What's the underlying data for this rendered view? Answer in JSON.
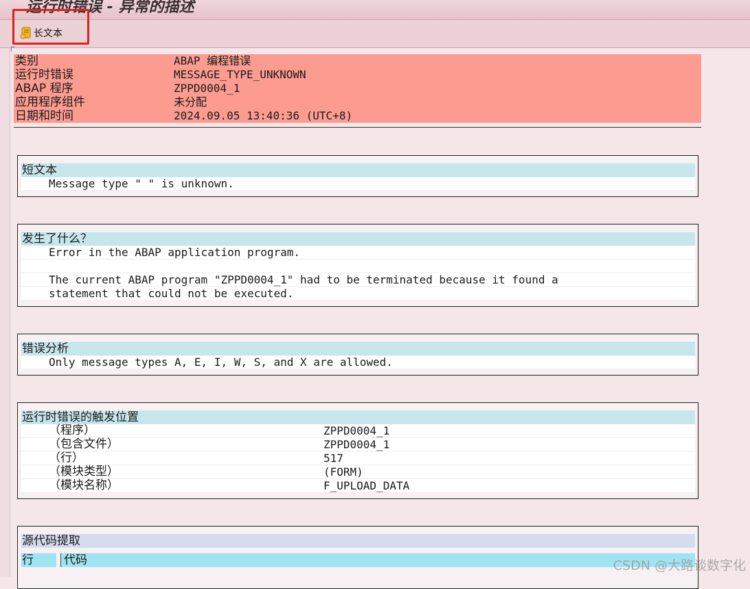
{
  "window": {
    "title": "运行时错误 - 异常的描述"
  },
  "toolbar": {
    "long_text_label": "长文本"
  },
  "header": {
    "rows": [
      {
        "key": "类别",
        "value": "ABAP 编程错误"
      },
      {
        "key": "运行时错误",
        "value": "MESSAGE_TYPE_UNKNOWN"
      },
      {
        "key": "ABAP 程序",
        "value": "ZPPD0004_1"
      },
      {
        "key": "应用程序组件",
        "value": "未分配"
      },
      {
        "key": "日期和时间",
        "value": "2024.09.05 13:40:36 (UTC+8)"
      }
    ]
  },
  "short_text": {
    "title": "短文本",
    "lines": [
      "Message type \" \" is unknown."
    ]
  },
  "what_happened": {
    "title": "发生了什么？",
    "lines": [
      "Error in the ABAP application program.",
      "",
      "The current ABAP program \"ZPPD0004_1\" had to be terminated because it found a",
      "statement that could not be executed."
    ]
  },
  "error_analysis": {
    "title": "错误分析",
    "lines": [
      "Only message types A, E, I, W, S, and X are allowed."
    ]
  },
  "trigger_location": {
    "title": "运行时错误的触发位置",
    "rows": [
      {
        "key": "（程序）",
        "value": "ZPPD0004_1"
      },
      {
        "key": "（包含文件）",
        "value": "ZPPD0004_1"
      },
      {
        "key": "（行）",
        "value": "517"
      },
      {
        "key": "（模块类型）",
        "value": "(FORM)"
      },
      {
        "key": "（模块名称）",
        "value": "F_UPLOAD_DATA"
      }
    ]
  },
  "source_extract": {
    "title": "源代码提取",
    "col_line": "行",
    "col_code": "代码"
  },
  "watermark": "CSDN @大路谈数字化"
}
